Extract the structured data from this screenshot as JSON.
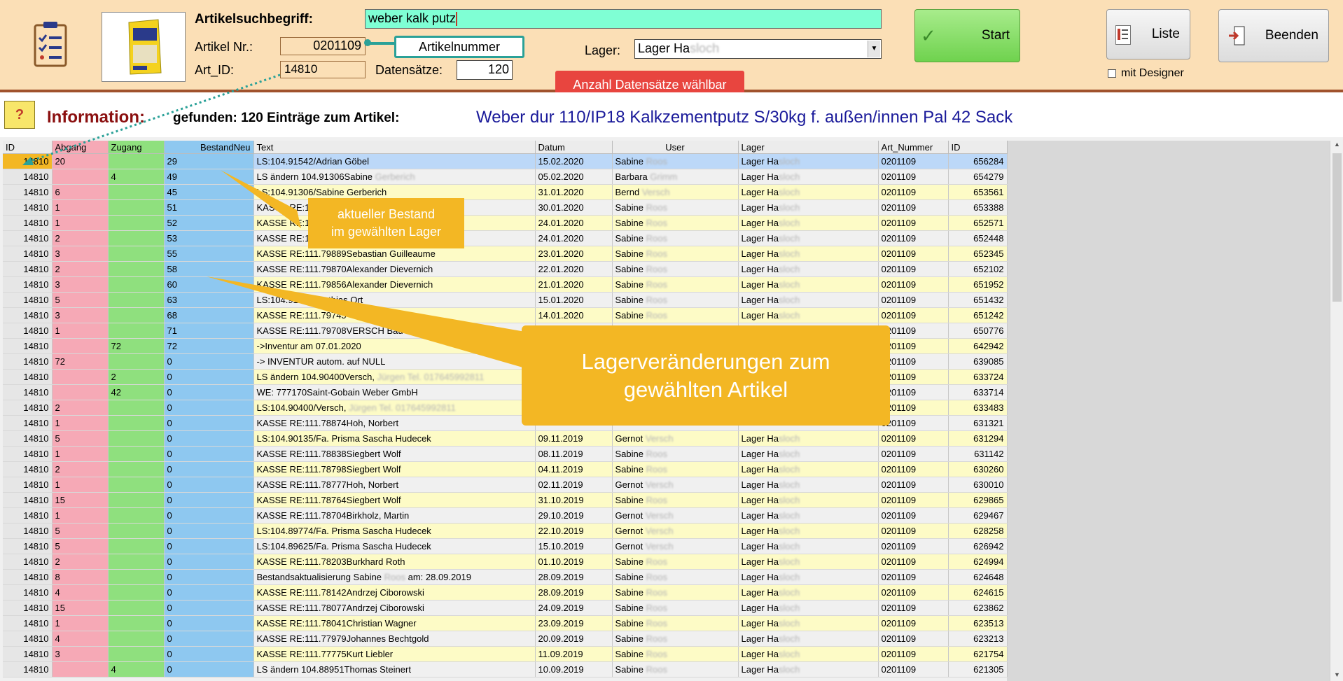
{
  "search": {
    "label": "Artikelsuchbegriff:",
    "value": "weber kalk putz"
  },
  "artikel_nr": {
    "label": "Artikel Nr.:",
    "value": "0201109"
  },
  "art_id": {
    "label": "Art_ID:",
    "value": "14810"
  },
  "datensaetze": {
    "label": "Datensätze:",
    "value": "120"
  },
  "lager": {
    "label": "Lager:",
    "value": "Lager Ha",
    "blurred": "sloch"
  },
  "buttons": {
    "start": "Start",
    "liste": "Liste",
    "beenden": "Beenden",
    "designer": "mit Designer"
  },
  "callouts": {
    "artikelnummer": "Artikelnummer",
    "anzahl": "Anzahl Datensätze wählbar",
    "bestand": [
      "aktueller Bestand",
      "im gewählten Lager"
    ],
    "veraenderungen": [
      "Lagerveränderungen zum",
      "gewählten Artikel"
    ]
  },
  "info": {
    "title": "Information:",
    "found": "gefunden: 120 Einträge zum Artikel:",
    "article": "Weber dur 110/IP18  Kalkzementputz S/30kg f. außen/innen Pal 42 Sack"
  },
  "colors": {
    "header_bg": "#fbdfb6",
    "abgang": "#f6a9b6",
    "zugang": "#8fe07e",
    "bestand": "#8ec8f0",
    "row_yellow": "#fdfbc6",
    "callout": "#f3b724",
    "callout_red": "#e8453f",
    "teal": "#2aa198"
  },
  "table": {
    "columns": [
      "ID",
      "Abgang",
      "Zugang",
      "BestandNeu",
      "Text",
      "Datum",
      "User",
      "Lager",
      "Art_Nummer",
      "ID"
    ],
    "rows": [
      {
        "id": "14810",
        "ab": "20",
        "zu": "",
        "be": "29",
        "txt": "LS:104.91542/Adrian Göbel",
        "dat": "15.02.2020",
        "usr": "Sabine ",
        "usr2": "Roos",
        "lag": "Lager Ha",
        "lag2": "sloch",
        "art": "0201109",
        "rid": "656284"
      },
      {
        "id": "14810",
        "ab": "",
        "zu": "4",
        "be": "49",
        "txt": "LS ändern 104.91306Sabine ",
        "txt2": "Gerberich",
        "dat": "05.02.2020",
        "usr": "Barbara ",
        "usr2": "Grimm",
        "lag": "Lager Ha",
        "lag2": "sloch",
        "art": "0201109",
        "rid": "654279"
      },
      {
        "id": "14810",
        "ab": "6",
        "zu": "",
        "be": "45",
        "txt": "LS:104.91306/Sabine Gerberich",
        "dat": "31.01.2020",
        "usr": "Bernd ",
        "usr2": "Versch",
        "lag": "Lager Ha",
        "lag2": "sloch",
        "art": "0201109",
        "rid": "653561"
      },
      {
        "id": "14810",
        "ab": "1",
        "zu": "",
        "be": "51",
        "txt": "KASSE RE:111.80011",
        "dat": "30.01.2020",
        "usr": "Sabine ",
        "usr2": "Roos",
        "lag": "Lager Ha",
        "lag2": "sloch",
        "art": "0201109",
        "rid": "653388"
      },
      {
        "id": "14810",
        "ab": "1",
        "zu": "",
        "be": "52",
        "txt": "KASSE RE:111.79950",
        "dat": "24.01.2020",
        "usr": "Sabine ",
        "usr2": "Roos",
        "lag": "Lager Ha",
        "lag2": "sloch",
        "art": "0201109",
        "rid": "652571"
      },
      {
        "id": "14810",
        "ab": "2",
        "zu": "",
        "be": "53",
        "txt": "KASSE RE:111.79911",
        "dat": "24.01.2020",
        "usr": "Sabine ",
        "usr2": "Roos",
        "lag": "Lager Ha",
        "lag2": "sloch",
        "art": "0201109",
        "rid": "652448"
      },
      {
        "id": "14810",
        "ab": "3",
        "zu": "",
        "be": "55",
        "txt": "KASSE RE:111.79889Sebastian Guilleaume",
        "dat": "23.01.2020",
        "usr": "Sabine ",
        "usr2": "Roos",
        "lag": "Lager Ha",
        "lag2": "sloch",
        "art": "0201109",
        "rid": "652345"
      },
      {
        "id": "14810",
        "ab": "2",
        "zu": "",
        "be": "58",
        "txt": "KASSE RE:111.79870Alexander Dievernich",
        "dat": "22.01.2020",
        "usr": "Sabine ",
        "usr2": "Roos",
        "lag": "Lager Ha",
        "lag2": "sloch",
        "art": "0201109",
        "rid": "652102"
      },
      {
        "id": "14810",
        "ab": "3",
        "zu": "",
        "be": "60",
        "txt": "KASSE RE:111.79856Alexander Dievernich",
        "dat": "21.01.2020",
        "usr": "Sabine ",
        "usr2": "Roos",
        "lag": "Lager Ha",
        "lag2": "sloch",
        "art": "0201109",
        "rid": "651952"
      },
      {
        "id": "14810",
        "ab": "5",
        "zu": "",
        "be": "63",
        "txt": "LS:104.91201/Mathias Ort",
        "dat": "15.01.2020",
        "usr": "Sabine ",
        "usr2": "Roos",
        "lag": "Lager Ha",
        "lag2": "sloch",
        "art": "0201109",
        "rid": "651432"
      },
      {
        "id": "14810",
        "ab": "3",
        "zu": "",
        "be": "68",
        "txt": "KASSE RE:111.79745",
        "dat": "14.01.2020",
        "usr": "Sabine ",
        "usr2": "Roos",
        "lag": "Lager Ha",
        "lag2": "sloch",
        "art": "0201109",
        "rid": "651242"
      },
      {
        "id": "14810",
        "ab": "1",
        "zu": "",
        "be": "71",
        "txt": "KASSE RE:111.79708VERSCH Bau",
        "dat": "",
        "usr": "",
        "usr2": "",
        "lag": "",
        "lag2": "",
        "art": "0201109",
        "rid": "650776"
      },
      {
        "id": "14810",
        "ab": "",
        "zu": "72",
        "be": "72",
        "txt": "->Inventur am 07.01.2020",
        "dat": "",
        "usr": "",
        "usr2": "",
        "lag": "",
        "lag2": "",
        "art": "0201109",
        "rid": "642942"
      },
      {
        "id": "14810",
        "ab": "72",
        "zu": "",
        "be": "0",
        "txt": "-> INVENTUR autom. auf NULL",
        "dat": "",
        "usr": "",
        "usr2": "",
        "lag": "",
        "lag2": "",
        "art": "0201109",
        "rid": "639085"
      },
      {
        "id": "14810",
        "ab": "",
        "zu": "2",
        "be": "0",
        "txt": "LS ändern 104.90400Versch, ",
        "txt2": "Jürgen Tel. 017645992811",
        "dat": "",
        "usr": "",
        "usr2": "",
        "lag": "",
        "lag2": "",
        "art": "0201109",
        "rid": "633724"
      },
      {
        "id": "14810",
        "ab": "",
        "zu": "42",
        "be": "0",
        "txt": "WE: 777170Saint-Gobain Weber GmbH",
        "dat": "",
        "usr": "",
        "usr2": "",
        "lag": "",
        "lag2": "",
        "art": "0201109",
        "rid": "633714"
      },
      {
        "id": "14810",
        "ab": "2",
        "zu": "",
        "be": "0",
        "txt": "LS:104.90400/Versch, ",
        "txt2": "Jürgen Tel. 017645992811",
        "dat": "",
        "usr": "",
        "usr2": "",
        "lag": "",
        "lag2": "",
        "art": "0201109",
        "rid": "633483"
      },
      {
        "id": "14810",
        "ab": "1",
        "zu": "",
        "be": "0",
        "txt": "KASSE RE:111.78874Hoh, Norbert",
        "dat": "",
        "usr": "",
        "usr2": "",
        "lag": "",
        "lag2": "",
        "art": "0201109",
        "rid": "631321"
      },
      {
        "id": "14810",
        "ab": "5",
        "zu": "",
        "be": "0",
        "txt": "LS:104.90135/Fa. Prisma Sascha Hudecek",
        "dat": "09.11.2019",
        "usr": "Gernot ",
        "usr2": "Versch",
        "lag": "Lager Ha",
        "lag2": "sloch",
        "art": "0201109",
        "rid": "631294"
      },
      {
        "id": "14810",
        "ab": "1",
        "zu": "",
        "be": "0",
        "txt": "KASSE RE:111.78838Siegbert Wolf",
        "dat": "08.11.2019",
        "usr": "Sabine ",
        "usr2": "Roos",
        "lag": "Lager Ha",
        "lag2": "sloch",
        "art": "0201109",
        "rid": "631142"
      },
      {
        "id": "14810",
        "ab": "2",
        "zu": "",
        "be": "0",
        "txt": "KASSE RE:111.78798Siegbert Wolf",
        "dat": "04.11.2019",
        "usr": "Sabine ",
        "usr2": "Roos",
        "lag": "Lager Ha",
        "lag2": "sloch",
        "art": "0201109",
        "rid": "630260"
      },
      {
        "id": "14810",
        "ab": "1",
        "zu": "",
        "be": "0",
        "txt": "KASSE RE:111.78777Hoh, Norbert",
        "dat": "02.11.2019",
        "usr": "Gernot ",
        "usr2": "Versch",
        "lag": "Lager Ha",
        "lag2": "sloch",
        "art": "0201109",
        "rid": "630010"
      },
      {
        "id": "14810",
        "ab": "15",
        "zu": "",
        "be": "0",
        "txt": "KASSE RE:111.78764Siegbert Wolf",
        "dat": "31.10.2019",
        "usr": "Sabine ",
        "usr2": "Roos",
        "lag": "Lager Ha",
        "lag2": "sloch",
        "art": "0201109",
        "rid": "629865"
      },
      {
        "id": "14810",
        "ab": "1",
        "zu": "",
        "be": "0",
        "txt": "KASSE RE:111.78704Birkholz, Martin",
        "dat": "29.10.2019",
        "usr": "Gernot ",
        "usr2": "Versch",
        "lag": "Lager Ha",
        "lag2": "sloch",
        "art": "0201109",
        "rid": "629467"
      },
      {
        "id": "14810",
        "ab": "5",
        "zu": "",
        "be": "0",
        "txt": "LS:104.89774/Fa. Prisma Sascha Hudecek",
        "dat": "22.10.2019",
        "usr": "Gernot ",
        "usr2": "Versch",
        "lag": "Lager Ha",
        "lag2": "sloch",
        "art": "0201109",
        "rid": "628258"
      },
      {
        "id": "14810",
        "ab": "5",
        "zu": "",
        "be": "0",
        "txt": "LS:104.89625/Fa. Prisma Sascha Hudecek",
        "dat": "15.10.2019",
        "usr": "Gernot ",
        "usr2": "Versch",
        "lag": "Lager Ha",
        "lag2": "sloch",
        "art": "0201109",
        "rid": "626942"
      },
      {
        "id": "14810",
        "ab": "2",
        "zu": "",
        "be": "0",
        "txt": "KASSE RE:111.78203Burkhard Roth",
        "dat": "01.10.2019",
        "usr": "Sabine ",
        "usr2": "Roos",
        "lag": "Lager Ha",
        "lag2": "sloch",
        "art": "0201109",
        "rid": "624994"
      },
      {
        "id": "14810",
        "ab": "8",
        "zu": "",
        "be": "0",
        "txt": "Bestandsaktualisierung  Sabine ",
        "txt2": "Roos",
        "txt3": "  am:  28.09.2019",
        "dat": "28.09.2019",
        "usr": "Sabine ",
        "usr2": "Roos",
        "lag": "Lager Ha",
        "lag2": "sloch",
        "art": "0201109",
        "rid": "624648"
      },
      {
        "id": "14810",
        "ab": "4",
        "zu": "",
        "be": "0",
        "txt": "KASSE RE:111.78142Andrzej Ciborowski",
        "dat": "28.09.2019",
        "usr": "Sabine ",
        "usr2": "Roos",
        "lag": "Lager Ha",
        "lag2": "sloch",
        "art": "0201109",
        "rid": "624615"
      },
      {
        "id": "14810",
        "ab": "15",
        "zu": "",
        "be": "0",
        "txt": "KASSE RE:111.78077Andrzej Ciborowski",
        "dat": "24.09.2019",
        "usr": "Sabine ",
        "usr2": "Roos",
        "lag": "Lager Ha",
        "lag2": "sloch",
        "art": "0201109",
        "rid": "623862"
      },
      {
        "id": "14810",
        "ab": "1",
        "zu": "",
        "be": "0",
        "txt": "KASSE RE:111.78041Christian Wagner",
        "dat": "23.09.2019",
        "usr": "Sabine ",
        "usr2": "Roos",
        "lag": "Lager Ha",
        "lag2": "sloch",
        "art": "0201109",
        "rid": "623513"
      },
      {
        "id": "14810",
        "ab": "4",
        "zu": "",
        "be": "0",
        "txt": "KASSE RE:111.77979Johannes Bechtgold",
        "dat": "20.09.2019",
        "usr": "Sabine ",
        "usr2": "Roos",
        "lag": "Lager Ha",
        "lag2": "sloch",
        "art": "0201109",
        "rid": "623213"
      },
      {
        "id": "14810",
        "ab": "3",
        "zu": "",
        "be": "0",
        "txt": "KASSE RE:111.77775Kurt Liebler",
        "dat": "11.09.2019",
        "usr": "Sabine ",
        "usr2": "Roos",
        "lag": "Lager Ha",
        "lag2": "sloch",
        "art": "0201109",
        "rid": "621754"
      },
      {
        "id": "14810",
        "ab": "",
        "zu": "4",
        "be": "0",
        "txt": "LS ändern 104.88951Thomas Steinert",
        "dat": "10.09.2019",
        "usr": "Sabine ",
        "usr2": "Roos",
        "lag": "Lager Ha",
        "lag2": "sloch",
        "art": "0201109",
        "rid": "621305"
      }
    ]
  }
}
